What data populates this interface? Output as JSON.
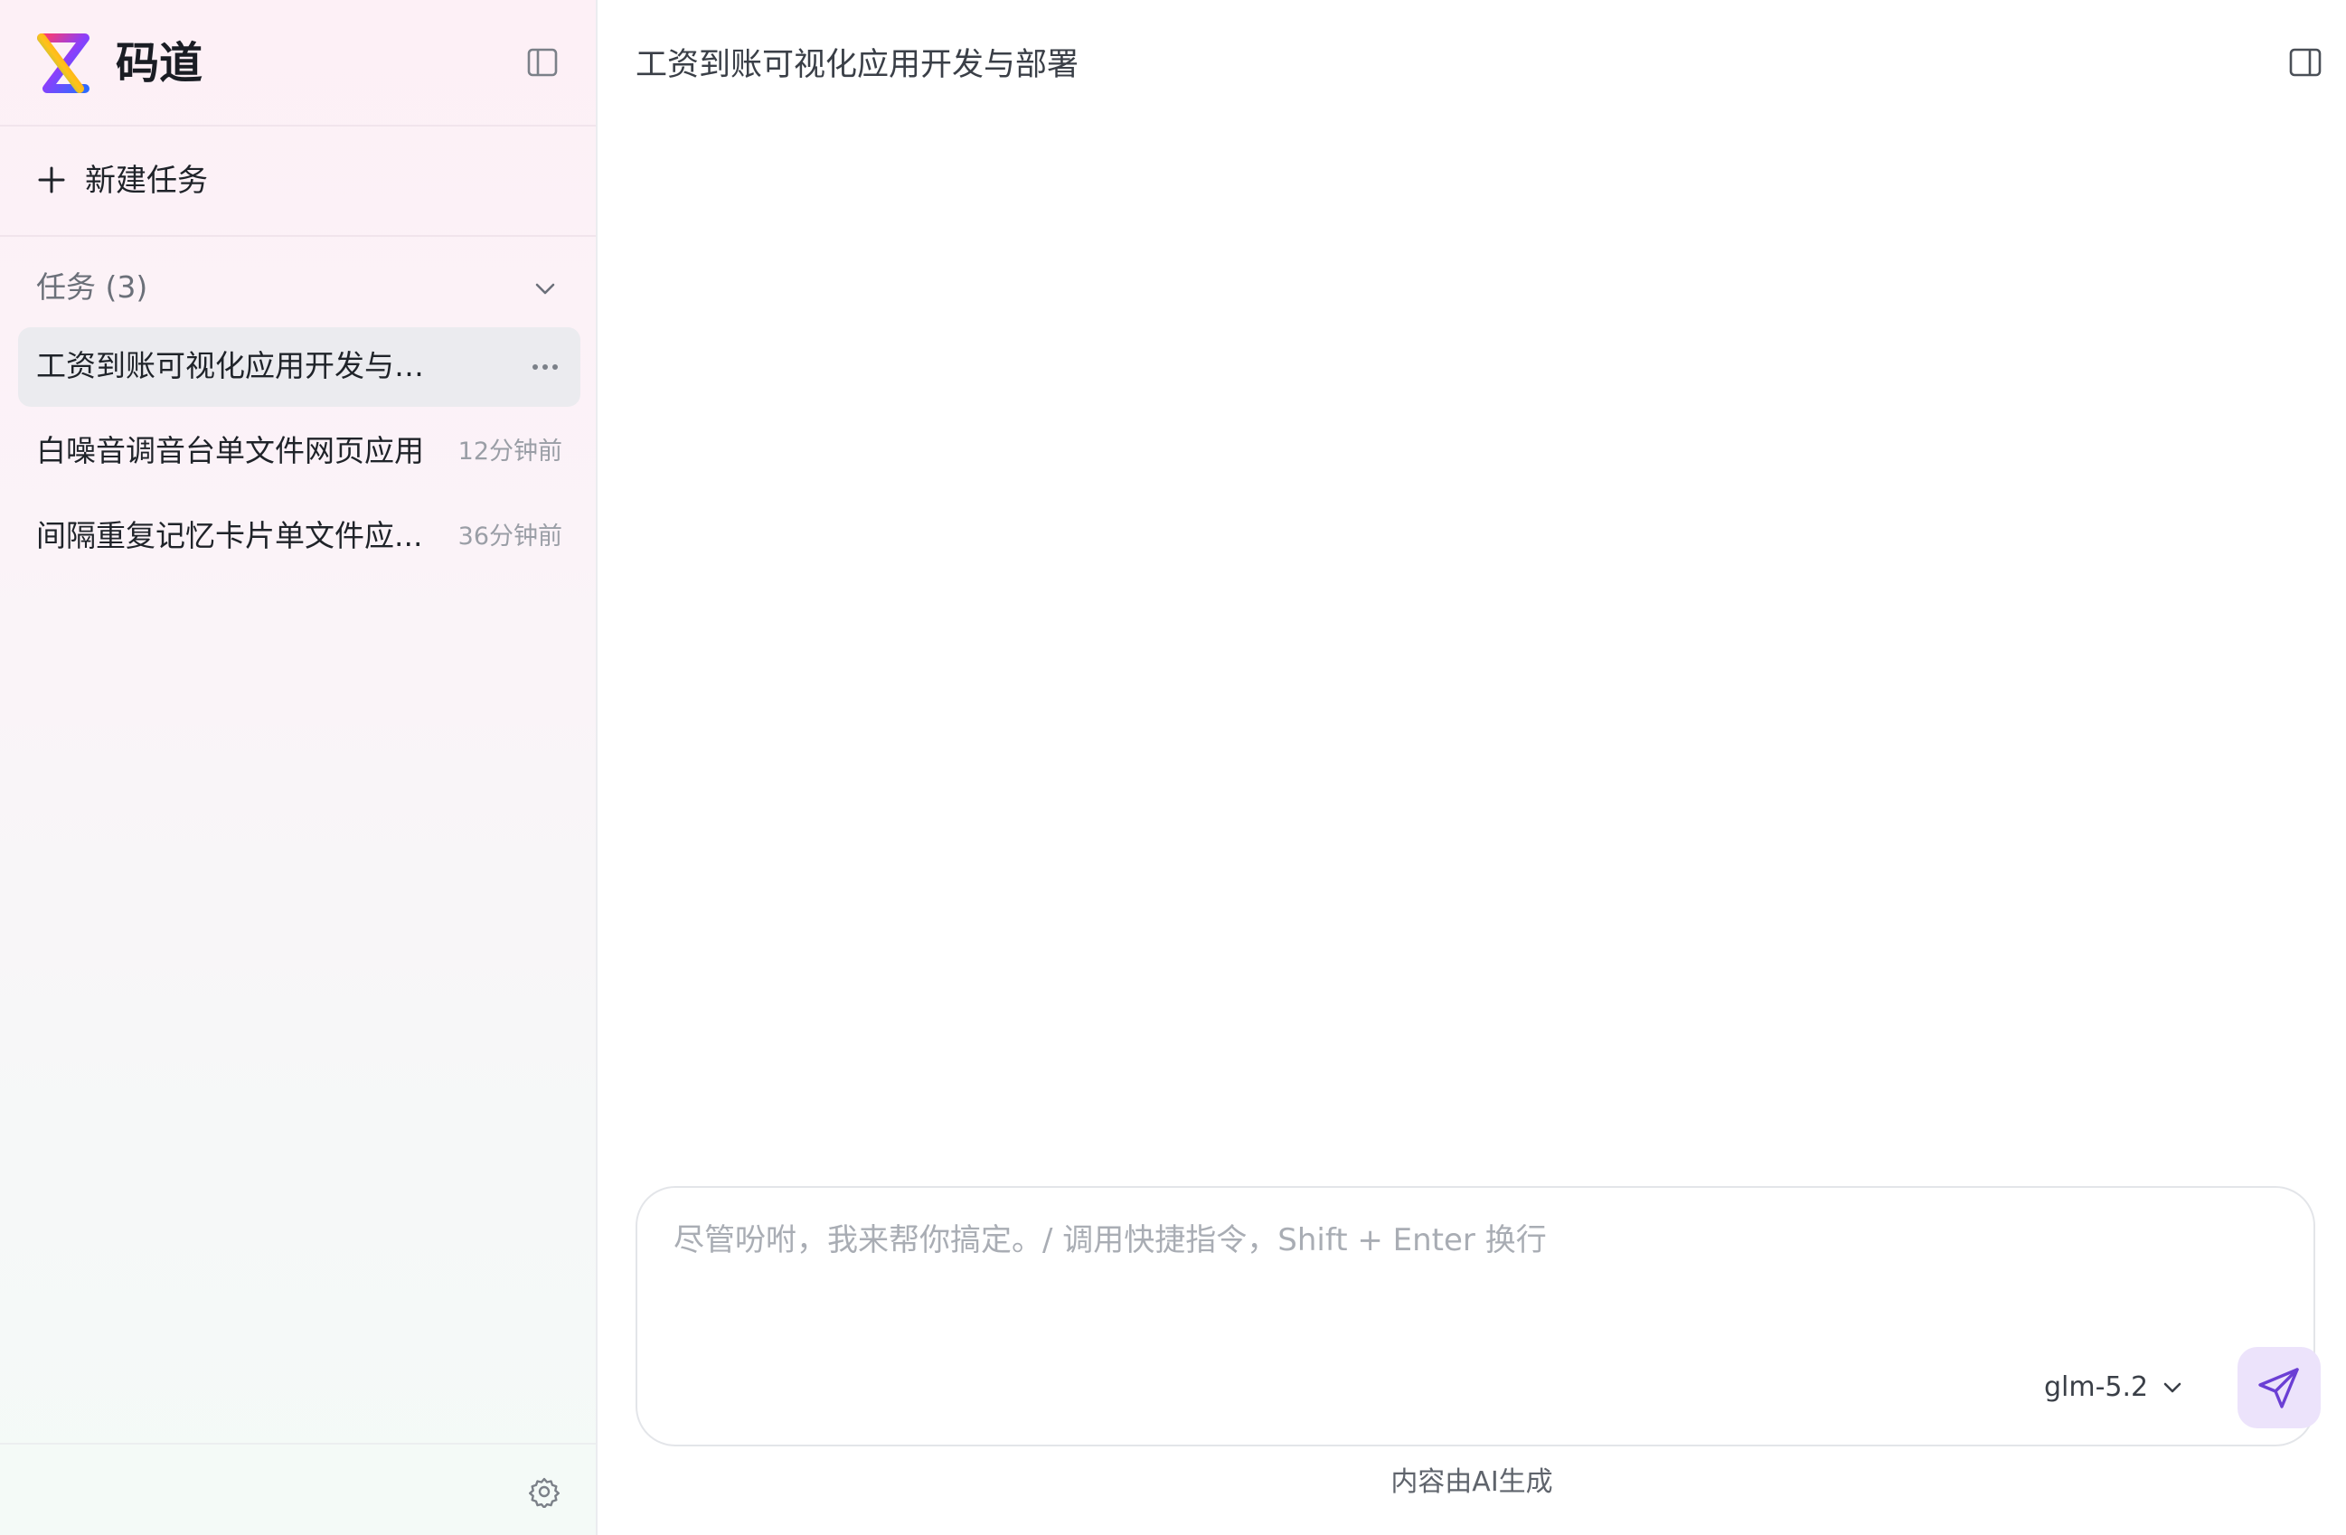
{
  "brand": {
    "name": "码道"
  },
  "sidebar": {
    "new_task_label": "新建任务",
    "tasks_header": "任务 (3)",
    "tasks": [
      {
        "title": "工资到账可视化应用开发与部署",
        "time": "",
        "active": true
      },
      {
        "title": "白噪音调音台单文件网页应用",
        "time": "12分钟前",
        "active": false
      },
      {
        "title": "间隔重复记忆卡片单文件应...",
        "time": "36分钟前",
        "active": false
      }
    ]
  },
  "main": {
    "title": "工资到账可视化应用开发与部署",
    "composer": {
      "placeholder": "尽管吩咐，我来帮你搞定。/ 调用快捷指令，Shift + Enter 换行",
      "value": "",
      "model": "glm-5.2"
    },
    "disclaimer": "内容由AI生成"
  },
  "icons": {
    "logo": "brand-logo-icon",
    "sidebar_toggle": "sidebar-toggle-icon",
    "plus": "plus-icon",
    "chevron": "chevron-down-icon",
    "more": "more-horizontal-icon",
    "settings": "gear-icon",
    "panel_toggle": "right-panel-icon",
    "send": "send-icon"
  },
  "colors": {
    "accent": "#6b3fd4",
    "send_bg": "#ece3fb",
    "active_item_bg": "#ebebef"
  }
}
